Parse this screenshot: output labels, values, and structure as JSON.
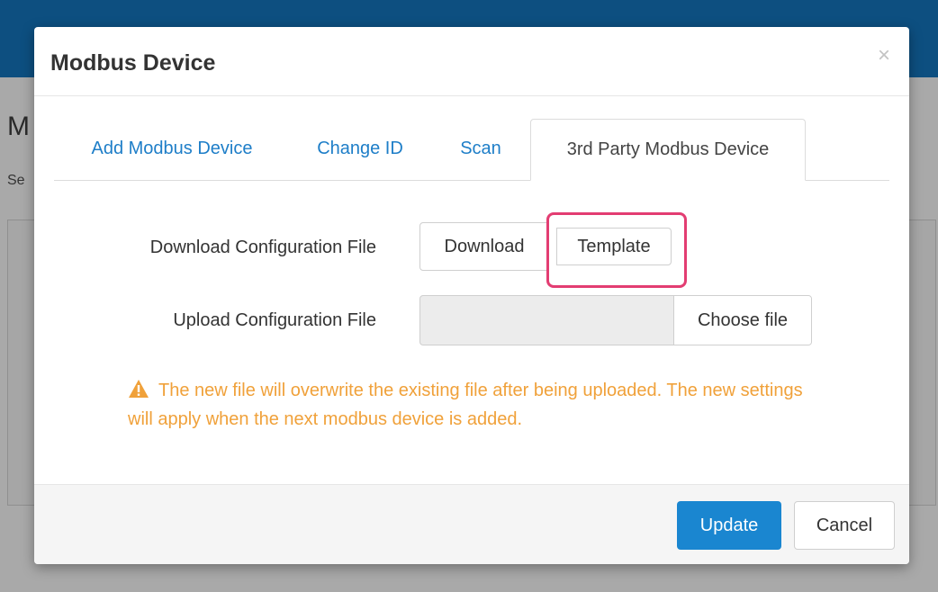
{
  "background": {
    "heading": "M",
    "subtext": "Se"
  },
  "modal": {
    "title": "Modbus Device",
    "close_glyph": "×",
    "tabs": [
      {
        "label": "Add Modbus Device",
        "active": false
      },
      {
        "label": "Change ID",
        "active": false
      },
      {
        "label": "Scan",
        "active": false
      },
      {
        "label": "3rd Party Modbus Device",
        "active": true
      }
    ],
    "download_row": {
      "label": "Download Configuration File",
      "download_button": "Download",
      "template_button": "Template"
    },
    "upload_row": {
      "label": "Upload Configuration File",
      "file_value": "",
      "choose_button": "Choose file"
    },
    "warning": {
      "icon": "warning-triangle-icon",
      "text": "The new file will overwrite the existing file after being uploaded. The new settings will apply when the next modbus device is added."
    },
    "footer": {
      "update_button": "Update",
      "cancel_button": "Cancel"
    }
  },
  "colors": {
    "accent": "#1a86d0",
    "tab_link": "#1e7ec8",
    "warning": "#f0a13a",
    "highlight": "#e33d72",
    "header_bar": "#0d4f80"
  }
}
